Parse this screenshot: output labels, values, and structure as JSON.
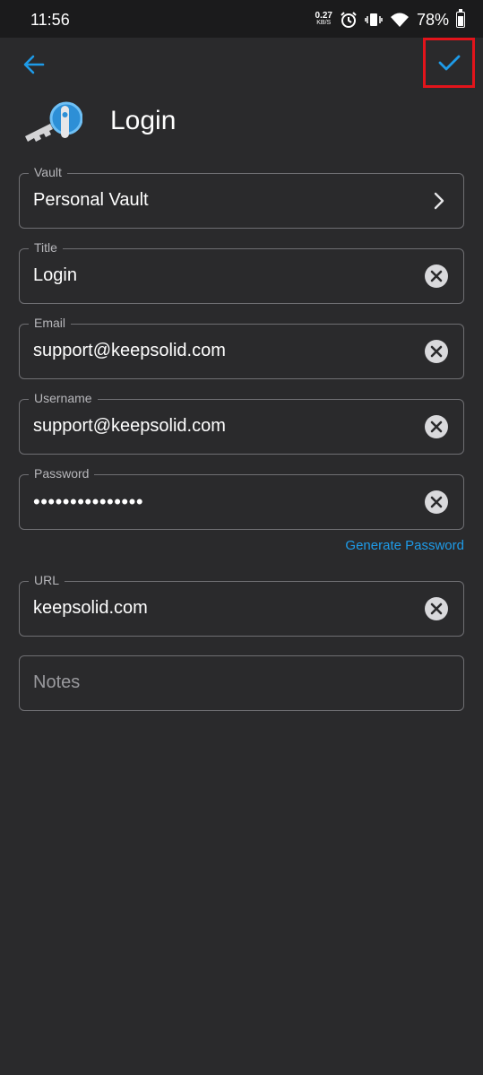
{
  "status_bar": {
    "time": "11:56",
    "net_speed_value": "0.27",
    "net_speed_unit": "KB/S",
    "battery": "78%",
    "icons": [
      "alarm-icon",
      "vibrate-icon",
      "wifi-icon",
      "battery-icon"
    ]
  },
  "toolbar": {
    "back_icon": "arrow-left-icon",
    "save_icon": "check-icon",
    "accent_color": "#1e9be8",
    "highlight_color": "#e2141b"
  },
  "header": {
    "icon": "key-icon",
    "title": "Login"
  },
  "fields": {
    "vault": {
      "label": "Vault",
      "value": "Personal Vault"
    },
    "title": {
      "label": "Title",
      "value": "Login"
    },
    "email": {
      "label": "Email",
      "value": "support@keepsolid.com"
    },
    "username": {
      "label": "Username",
      "value": "support@keepsolid.com"
    },
    "password": {
      "label": "Password",
      "value": "•••••••••••••••"
    },
    "url": {
      "label": "URL",
      "value": "keepsolid.com"
    },
    "notes": {
      "placeholder": "Notes"
    }
  },
  "generate_password_label": "Generate Password"
}
